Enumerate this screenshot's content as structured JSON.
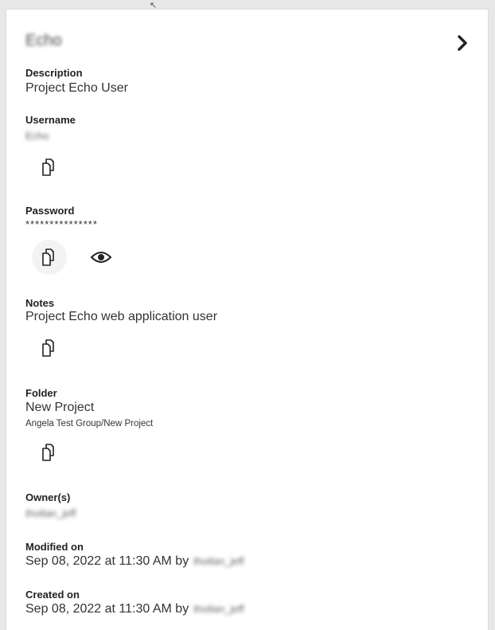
{
  "cursor_icon": "cursor-icon",
  "header": {
    "title": "Echo"
  },
  "fields": {
    "description": {
      "label": "Description",
      "value": "Project Echo User"
    },
    "username": {
      "label": "Username",
      "value": "Echo"
    },
    "password": {
      "label": "Password",
      "value": "***************"
    },
    "notes": {
      "label": "Notes",
      "value": "Project Echo web application user"
    },
    "folder": {
      "label": "Folder",
      "value": "New Project",
      "path": "Angela Test Group/New Project"
    },
    "owners": {
      "label": "Owner(s)",
      "value": "thotlan_jeff"
    },
    "modified": {
      "label": "Modified on",
      "value": "Sep 08, 2022 at 11:30 AM by",
      "user": "thotlan_jeff"
    },
    "created": {
      "label": "Created on",
      "value": "Sep 08, 2022 at 11:30 AM by",
      "user": "thotlan_jeff"
    }
  },
  "icons": {
    "chevron": "chevron-right-icon",
    "copy": "copy-icon",
    "eye": "eye-icon"
  }
}
